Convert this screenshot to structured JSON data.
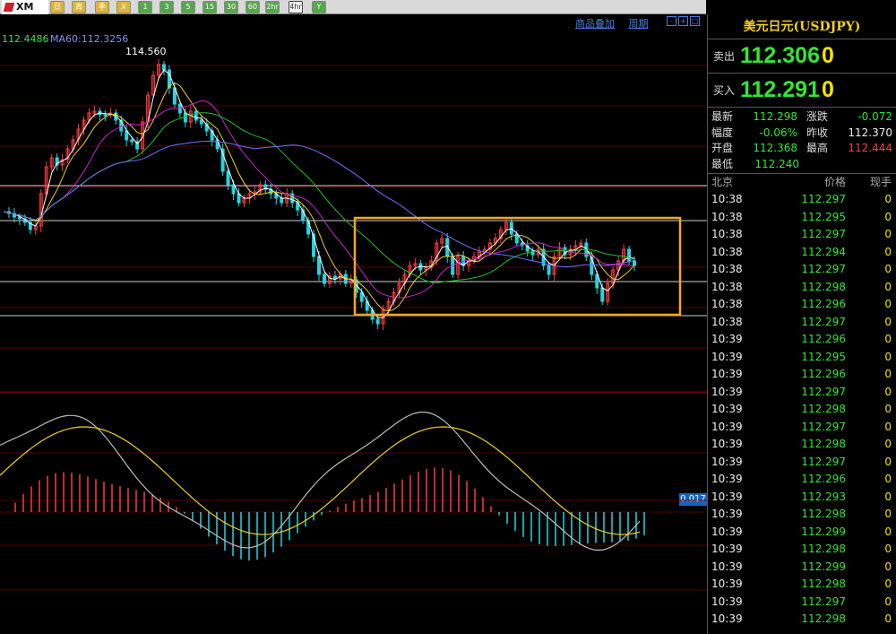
{
  "toolbar": {
    "logo": "XM",
    "buttons": [
      {
        "label": "日",
        "style": "y"
      },
      {
        "label": "周",
        "style": "y"
      },
      {
        "label": "季",
        "style": "y"
      },
      {
        "label": "X",
        "style": "y"
      },
      {
        "label": "1",
        "style": "g"
      },
      {
        "label": "3",
        "style": "g"
      },
      {
        "label": "5",
        "style": "g"
      },
      {
        "label": "15",
        "style": "g"
      },
      {
        "label": "30",
        "style": "g"
      },
      {
        "label": "60",
        "style": "g"
      },
      {
        "label": "2hr",
        "style": "g"
      },
      {
        "label": "4hr",
        "style": "w"
      },
      {
        "label": "Y",
        "style": "g"
      }
    ]
  },
  "chart_header": {
    "links": [
      "商品叠加",
      "周期"
    ],
    "ma_labels": [
      {
        "text": "112.4486",
        "color": "#33e633"
      },
      {
        "text": "MA60:112.3256",
        "color": "#8a8cff"
      }
    ],
    "high_label": "114.560",
    "macd_value": "0.017"
  },
  "panel": {
    "title": "美元日元(USDJPY)",
    "sell_label": "卖出",
    "sell_price": "112.306",
    "sell_extra": "0",
    "buy_label": "买入",
    "buy_price": "112.291",
    "buy_extra": "0",
    "stats": [
      {
        "k": "最新",
        "v": "112.298",
        "k2": "涨跌",
        "v2": "-0.072",
        "v2color": "#33e633"
      },
      {
        "k": "幅度",
        "v": "-0.06%",
        "k2": "昨收",
        "v2": "112.370",
        "v2color": "#eeeeee"
      },
      {
        "k": "开盘",
        "v": "112.368",
        "k2": "最高",
        "v2": "112.444",
        "v2color": "#ff3b3b"
      },
      {
        "k": "最低",
        "v": "112.240",
        "k2": "",
        "v2": "",
        "v2color": "#eeeeee"
      }
    ],
    "ticks_header": {
      "time": "北京",
      "price": "价格",
      "vol": "现手"
    },
    "ticks": [
      {
        "t": "10:38",
        "p": "112.297",
        "v": "0"
      },
      {
        "t": "10:38",
        "p": "112.295",
        "v": "0"
      },
      {
        "t": "10:38",
        "p": "112.297",
        "v": "0"
      },
      {
        "t": "10:38",
        "p": "112.294",
        "v": "0"
      },
      {
        "t": "10:38",
        "p": "112.297",
        "v": "0"
      },
      {
        "t": "10:38",
        "p": "112.298",
        "v": "0"
      },
      {
        "t": "10:38",
        "p": "112.296",
        "v": "0"
      },
      {
        "t": "10:38",
        "p": "112.297",
        "v": "0"
      },
      {
        "t": "10:39",
        "p": "112.296",
        "v": "0"
      },
      {
        "t": "10:39",
        "p": "112.295",
        "v": "0"
      },
      {
        "t": "10:39",
        "p": "112.296",
        "v": "0"
      },
      {
        "t": "10:39",
        "p": "112.297",
        "v": "0"
      },
      {
        "t": "10:39",
        "p": "112.298",
        "v": "0"
      },
      {
        "t": "10:39",
        "p": "112.297",
        "v": "0"
      },
      {
        "t": "10:39",
        "p": "112.298",
        "v": "0"
      },
      {
        "t": "10:39",
        "p": "112.297",
        "v": "0"
      },
      {
        "t": "10:39",
        "p": "112.296",
        "v": "0"
      },
      {
        "t": "10:39",
        "p": "112.293",
        "v": "0"
      },
      {
        "t": "10:39",
        "p": "112.298",
        "v": "0"
      },
      {
        "t": "10:39",
        "p": "112.299",
        "v": "0"
      },
      {
        "t": "10:39",
        "p": "112.298",
        "v": "0"
      },
      {
        "t": "10:39",
        "p": "112.299",
        "v": "0"
      },
      {
        "t": "10:39",
        "p": "112.298",
        "v": "0"
      },
      {
        "t": "10:39",
        "p": "112.297",
        "v": "0"
      },
      {
        "t": "10:39",
        "p": "112.298",
        "v": "0"
      }
    ]
  },
  "chart_data": {
    "type": "candlestick",
    "bullish_color": "#ff3b3b",
    "bearish_color": "#22d6e0",
    "highlight_box_color": "#f5a623",
    "ma_colors": [
      "#ffffff",
      "#f0d020",
      "#d020d0",
      "#20c020",
      "#7070ff"
    ],
    "macd_colors": {
      "dif": "#bbbbbb",
      "dea": "#f0d020"
    }
  }
}
